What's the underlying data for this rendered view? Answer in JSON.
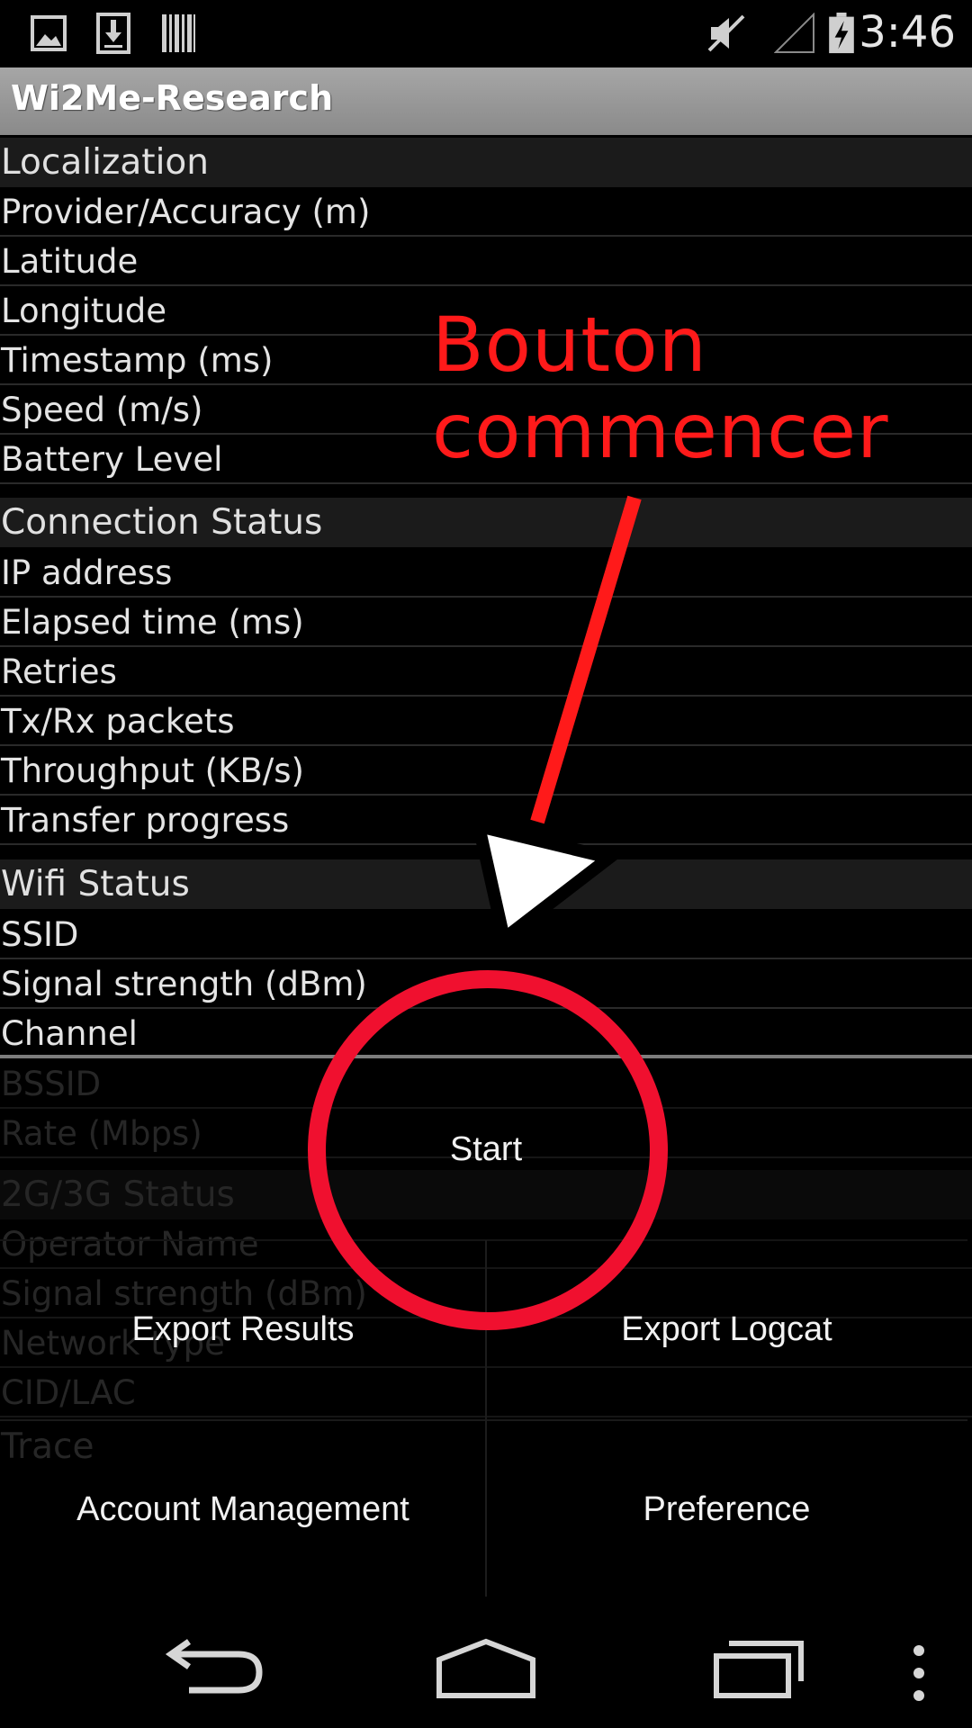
{
  "status_bar": {
    "time": "3:46",
    "icons": [
      "image-icon",
      "download-icon",
      "barcode-icon",
      "muted-speaker-icon",
      "no-signal-icon",
      "battery-charging-icon"
    ]
  },
  "app": {
    "title": "Wi2Me-Research"
  },
  "localization": {
    "header": "Localization",
    "rows": [
      "Provider/Accuracy (m)",
      "Latitude",
      "Longitude",
      "Timestamp (ms)",
      "Speed (m/s)",
      "Battery Level"
    ]
  },
  "connection": {
    "header": "Connection Status",
    "rows": [
      "IP address",
      "Elapsed time (ms)",
      "Retries",
      "Tx/Rx packets",
      "Throughput (KB/s)",
      "Transfer progress"
    ]
  },
  "wifi": {
    "header": "Wifi Status",
    "rows": [
      "SSID",
      "Signal strength (dBm)",
      "Channel",
      "BSSID",
      "Rate (Mbps)"
    ]
  },
  "cellular": {
    "header": "2G/3G Status",
    "rows": [
      "Operator Name",
      "Signal strength (dBm)",
      "Network type",
      "CID/LAC"
    ]
  },
  "trace": {
    "header": "Trace"
  },
  "menu": {
    "start": "Start",
    "export_results": "Export Results",
    "export_logcat": "Export Logcat",
    "account_management": "Account Management",
    "preference": "Preference"
  },
  "annotation": {
    "line1": "Bouton",
    "line2": "commencer",
    "color": "#ff1a1a",
    "circle_color": "#f0102f"
  },
  "nav_bar": {
    "icons": [
      "back-icon",
      "home-icon",
      "recent-apps-icon",
      "overflow-menu-icon"
    ]
  }
}
